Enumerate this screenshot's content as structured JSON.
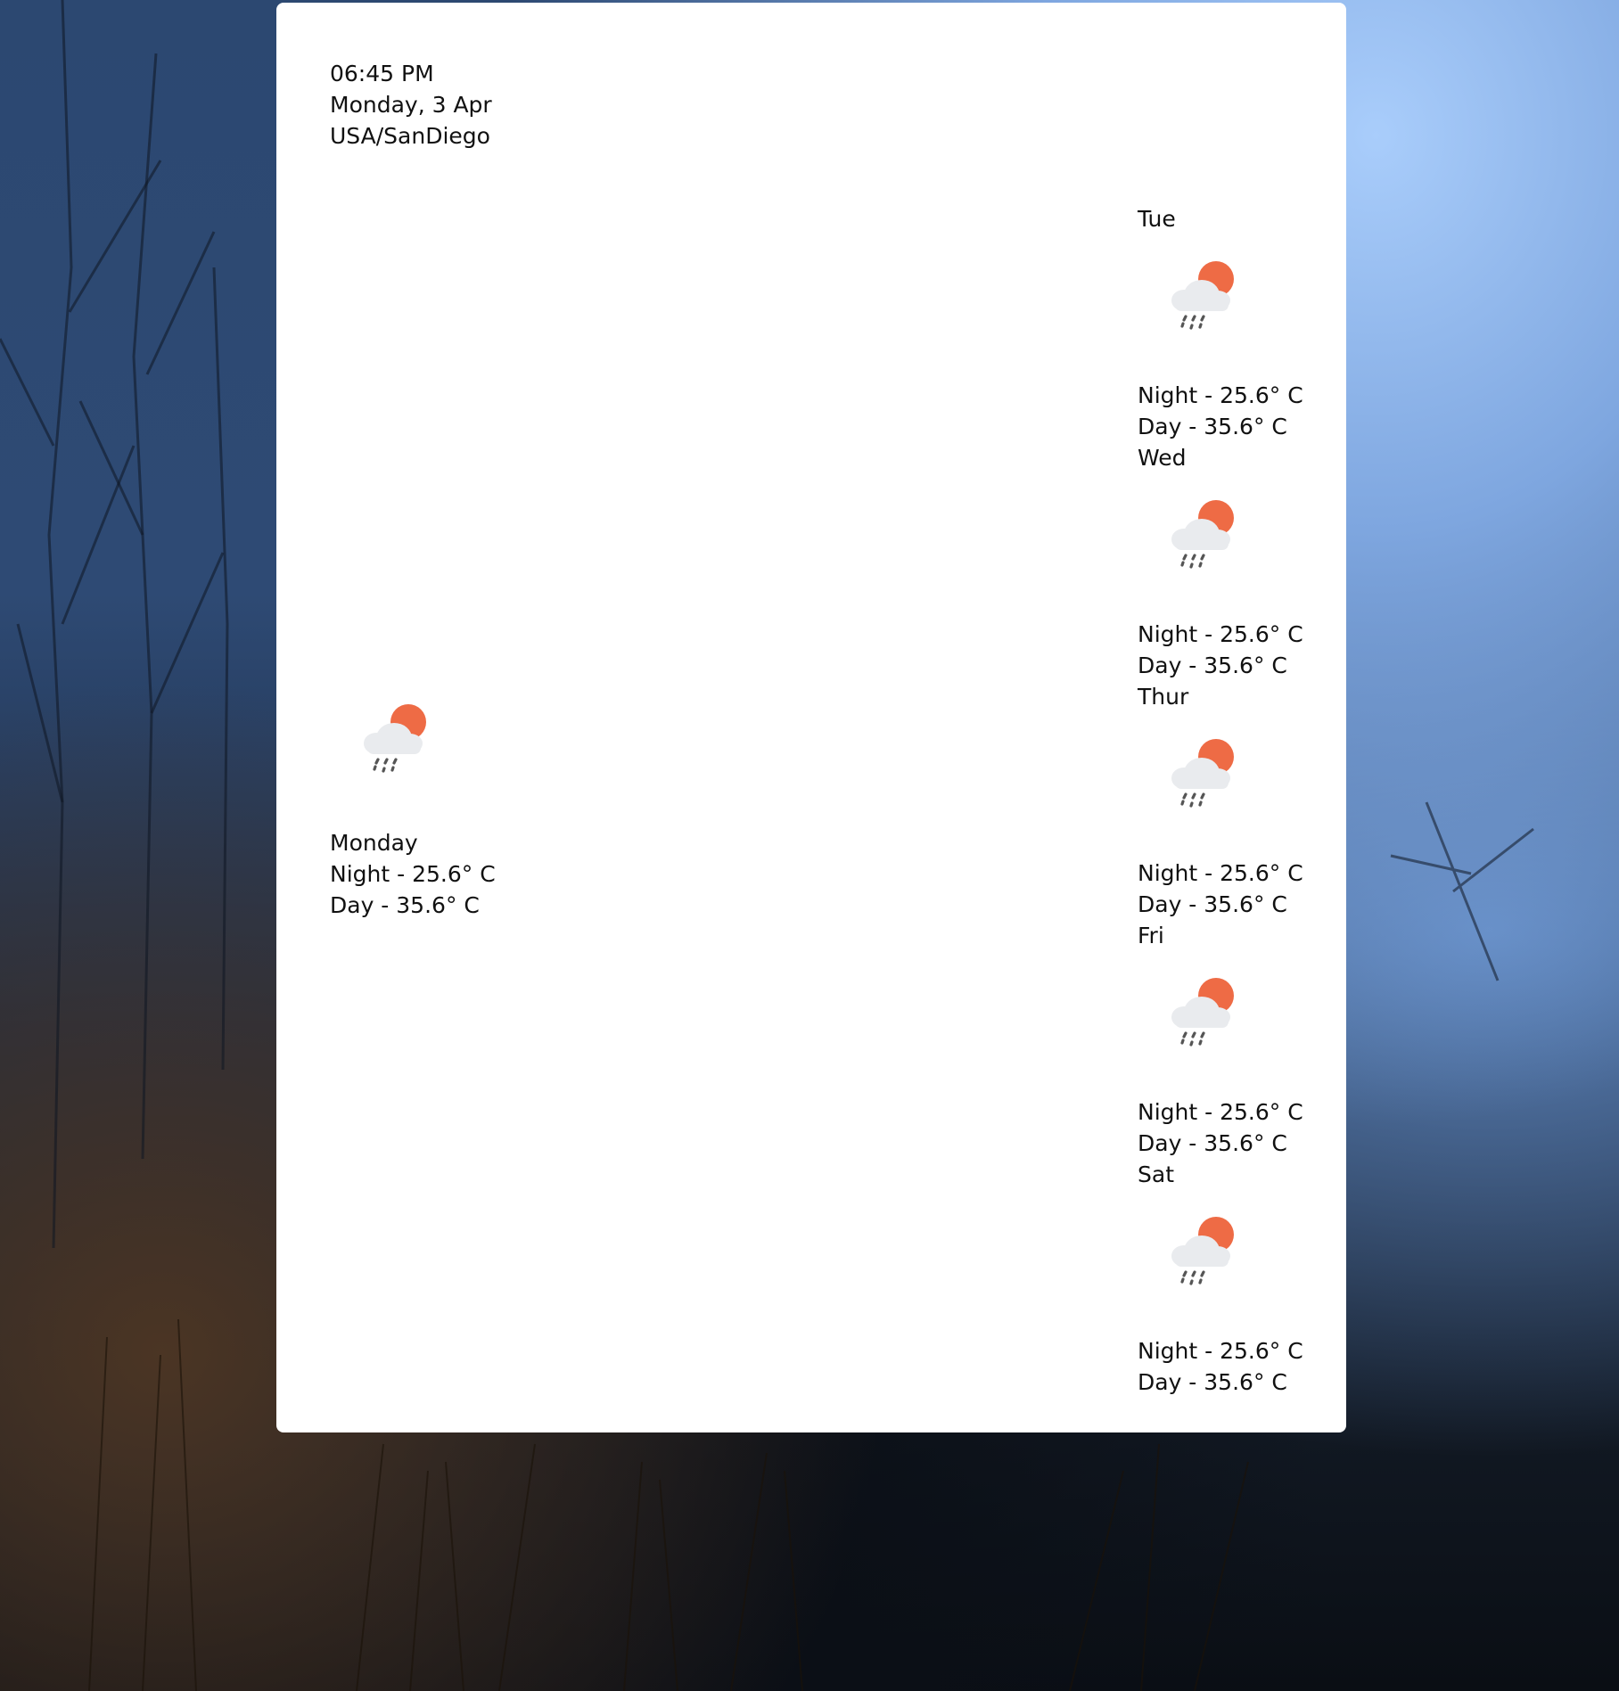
{
  "header": {
    "time": "06:45 PM",
    "date": "Monday, 3 Apr",
    "location": "USA/SanDiego"
  },
  "today": {
    "day": "Monday",
    "night": "Night - 25.6° C",
    "dayTemp": "Day - 35.6° C",
    "icon": "rain-cloud-sun-icon"
  },
  "forecast": [
    {
      "day": "Tue",
      "night": "Night - 25.6° C",
      "dayTemp": "Day - 35.6° C",
      "icon": "rain-cloud-sun-icon"
    },
    {
      "day": "Wed",
      "night": "Night - 25.6° C",
      "dayTemp": "Day - 35.6° C",
      "icon": "rain-cloud-sun-icon"
    },
    {
      "day": "Thur",
      "night": "Night - 25.6° C",
      "dayTemp": "Day - 35.6° C",
      "icon": "rain-cloud-sun-icon"
    },
    {
      "day": "Fri",
      "night": "Night - 25.6° C",
      "dayTemp": "Day - 35.6° C",
      "icon": "rain-cloud-sun-icon"
    },
    {
      "day": "Sat",
      "night": "Night - 25.6° C",
      "dayTemp": "Day - 35.6° C",
      "icon": "rain-cloud-sun-icon"
    }
  ],
  "colors": {
    "sun": "#ee6b45",
    "cloud": "#e9ebee",
    "rain": "#555555",
    "panel": "#ffffff"
  }
}
